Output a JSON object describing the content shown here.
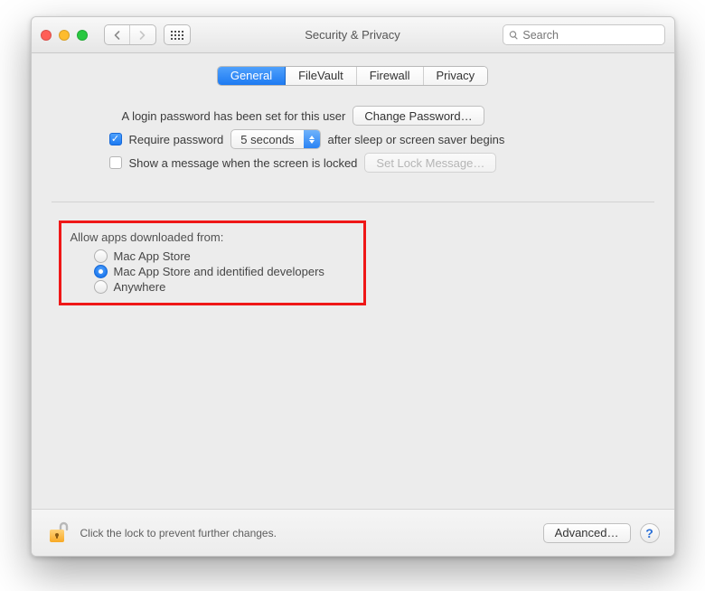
{
  "window": {
    "title": "Security & Privacy"
  },
  "search": {
    "placeholder": "Search"
  },
  "tabs": [
    {
      "label": "General",
      "active": true
    },
    {
      "label": "FileVault",
      "active": false
    },
    {
      "label": "Firewall",
      "active": false
    },
    {
      "label": "Privacy",
      "active": false
    }
  ],
  "login_section": {
    "password_set_text": "A login password has been set for this user",
    "change_password_label": "Change Password…",
    "require_password": {
      "checked": true,
      "pre_label": "Require password",
      "delay_value": "5 seconds",
      "post_label": "after sleep or screen saver begins"
    },
    "lock_message": {
      "checked": false,
      "label": "Show a message when the screen is locked",
      "button_label": "Set Lock Message…",
      "button_enabled": false
    }
  },
  "allow_apps": {
    "title": "Allow apps downloaded from:",
    "options": [
      {
        "label": "Mac App Store",
        "selected": false
      },
      {
        "label": "Mac App Store and identified developers",
        "selected": true
      },
      {
        "label": "Anywhere",
        "selected": false
      }
    ]
  },
  "footer": {
    "lock_text": "Click the lock to prevent further changes.",
    "advanced_label": "Advanced…",
    "help_label": "?"
  }
}
